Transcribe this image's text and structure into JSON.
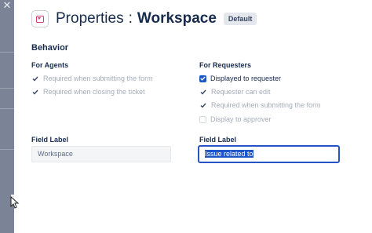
{
  "header": {
    "title_prefix": "Properties",
    "separator": ":",
    "title_name": "Workspace",
    "badge": "Default"
  },
  "behavior": {
    "title": "Behavior",
    "agents": {
      "title": "For Agents",
      "options": [
        {
          "label": "Required when submitting the form",
          "checked": true,
          "enabled": false
        },
        {
          "label": "Required when closing the ticket",
          "checked": true,
          "enabled": false
        }
      ]
    },
    "requesters": {
      "title": "For Requesters",
      "options": [
        {
          "label": "Displayed to requester",
          "checked": true,
          "enabled": true
        },
        {
          "label": "Requester can edit",
          "checked": true,
          "enabled": false
        },
        {
          "label": "Required when submitting the form",
          "checked": true,
          "enabled": false
        },
        {
          "label": "Display to approver",
          "checked": false,
          "enabled": false
        }
      ]
    }
  },
  "fields": {
    "agent_label": {
      "title": "Field Label",
      "value": "Workspace"
    },
    "requester_label": {
      "title": "Field Label",
      "value": "Issue related to"
    }
  },
  "colors": {
    "accent": "#1d57c7",
    "icon_pink": "#d63a6c"
  },
  "icons": {
    "close": "close-icon",
    "form": "form-icon",
    "check": "check-icon"
  }
}
